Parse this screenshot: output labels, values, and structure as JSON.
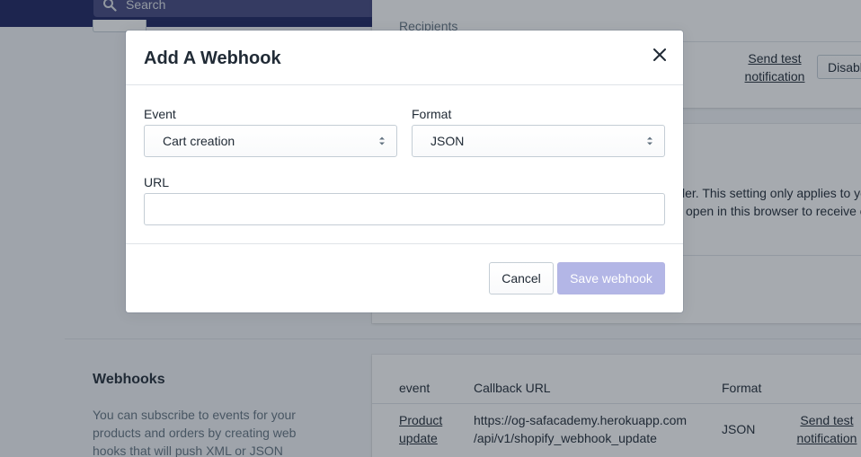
{
  "topbar": {
    "search_placeholder": "Search"
  },
  "background": {
    "card1": {
      "partial_label": "Recipients",
      "send_test_link": "Send test notification",
      "disable_button": "Disable"
    },
    "card2": {
      "line1": "ler. This setting only applies to yo",
      "line2": "open in this browser to receive c"
    },
    "webhooks": {
      "title": "Webhooks",
      "description": "You can subscribe to events for your products and orders by creating web hooks that will push XML or JSON",
      "columns": [
        "event",
        "Callback URL",
        "Format"
      ],
      "rows": [
        {
          "event": "Product update",
          "callback_url": "https://og-safacademy.herokuapp.com /api/v1/shopify_webhook_update",
          "format": "JSON",
          "action": "Send test notification"
        }
      ]
    }
  },
  "modal": {
    "title": "Add A Webhook",
    "event_label": "Event",
    "event_value": "Cart creation",
    "format_label": "Format",
    "format_value": "JSON",
    "url_label": "URL",
    "url_value": "",
    "cancel_label": "Cancel",
    "save_label": "Save webhook"
  },
  "colors": {
    "topbar": "#1c2260",
    "primary_disabled": "#b3b6e6",
    "overlay": "rgba(33,43,54,0.4)"
  },
  "icons": [
    "search-icon",
    "close-icon",
    "select-chevron-icon"
  ]
}
